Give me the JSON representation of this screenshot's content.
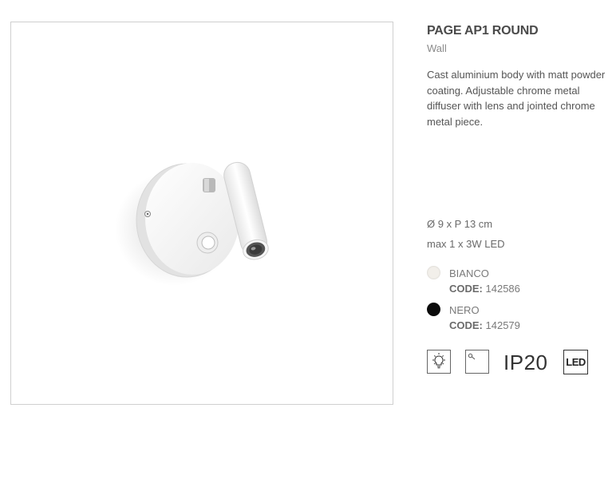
{
  "product": {
    "title": "PAGE AP1 ROUND",
    "category": "Wall",
    "description": "Cast aluminium body with matt powder coating. Adjustable chrome metal diffuser with lens and jointed chrome metal piece."
  },
  "specs": {
    "dimensions": "Ø 9 x P 13 cm",
    "power": "max 1 x 3W LED"
  },
  "variants": [
    {
      "color_name": "BIANCO",
      "code_label": "CODE:",
      "code": "142586",
      "swatch": "#f2efea"
    },
    {
      "color_name": "NERO",
      "code_label": "CODE:",
      "code": "142579",
      "swatch": "#0b0b0b"
    }
  ],
  "certifications": {
    "icons": [
      "bulb-class-icon",
      "on-off-switch-icon"
    ],
    "ip_rating": "IP20",
    "led_label": "LED"
  }
}
